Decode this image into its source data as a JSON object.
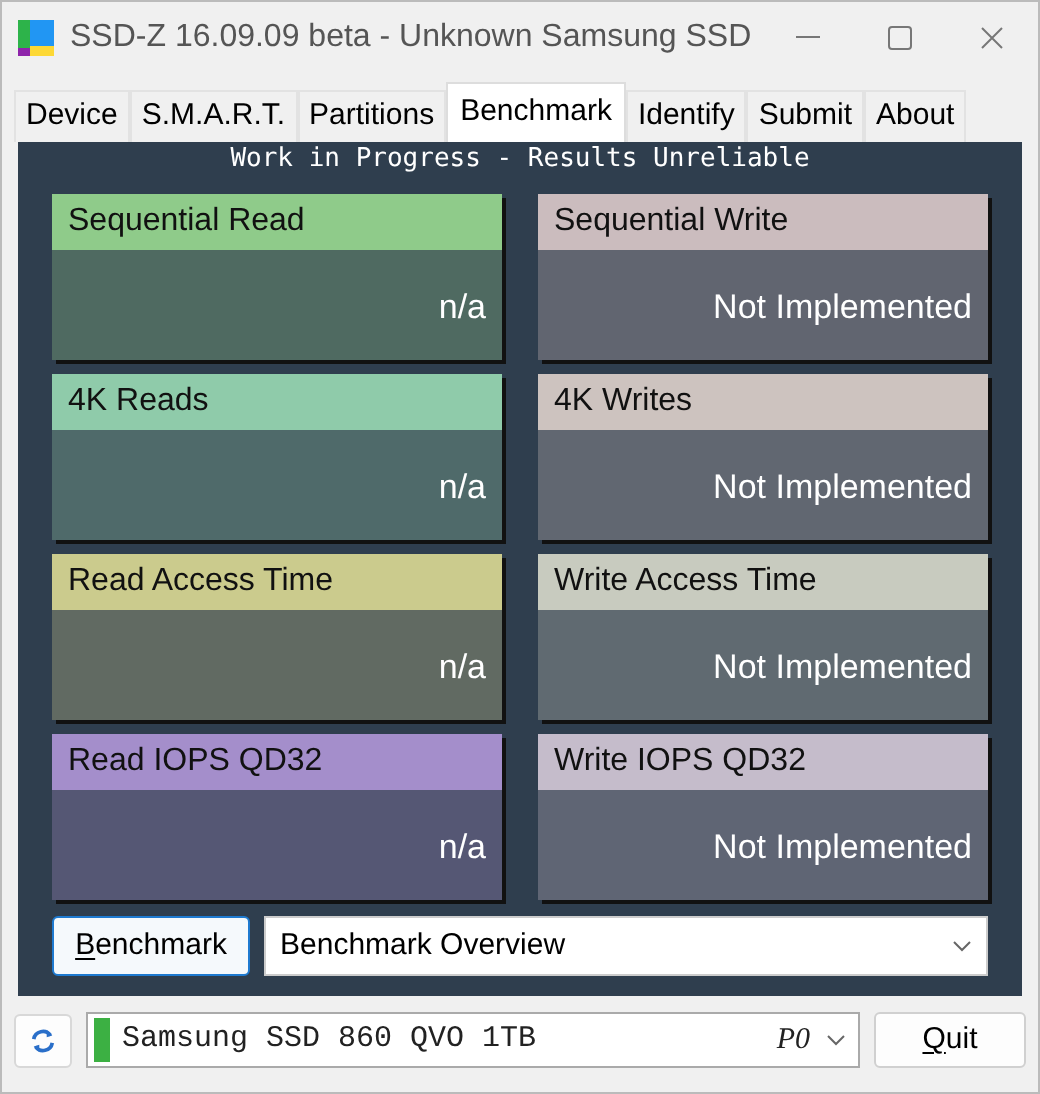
{
  "window": {
    "title": "SSD-Z 16.09.09 beta - Unknown Samsung SSD"
  },
  "tabs": [
    {
      "label": "Device",
      "selected": false
    },
    {
      "label": "S.M.A.R.T.",
      "selected": false
    },
    {
      "label": "Partitions",
      "selected": false
    },
    {
      "label": "Benchmark",
      "selected": true
    },
    {
      "label": "Identify",
      "selected": false
    },
    {
      "label": "Submit",
      "selected": false
    },
    {
      "label": "About",
      "selected": false
    }
  ],
  "banner": "Work in Progress - Results Unreliable",
  "tiles": [
    {
      "title": "Sequential Read",
      "value": "n/a",
      "color": "#8fcb8a"
    },
    {
      "title": "Sequential Write",
      "value": "Not Implemented",
      "color": "#cbbcbe"
    },
    {
      "title": "4K Reads",
      "value": "n/a",
      "color": "#8fcbaa"
    },
    {
      "title": "4K Writes",
      "value": "Not Implemented",
      "color": "#cdc3bf"
    },
    {
      "title": "Read Access Time",
      "value": "n/a",
      "color": "#cbcb8d"
    },
    {
      "title": "Write Access Time",
      "value": "Not Implemented",
      "color": "#c8cbbf"
    },
    {
      "title": "Read IOPS QD32",
      "value": "n/a",
      "color": "#a48ecb"
    },
    {
      "title": "Write IOPS QD32",
      "value": "Not Implemented",
      "color": "#c5bccb"
    }
  ],
  "benchmark_button": {
    "label": "Benchmark",
    "first_letter_underlined": true
  },
  "view_select": {
    "value": "Benchmark Overview"
  },
  "drive_select": {
    "value": "Samsung SSD 860 QVO 1TB",
    "port": "P0",
    "healthy": true
  },
  "quit_button": {
    "label": "Quit",
    "first_letter_underlined": true
  }
}
